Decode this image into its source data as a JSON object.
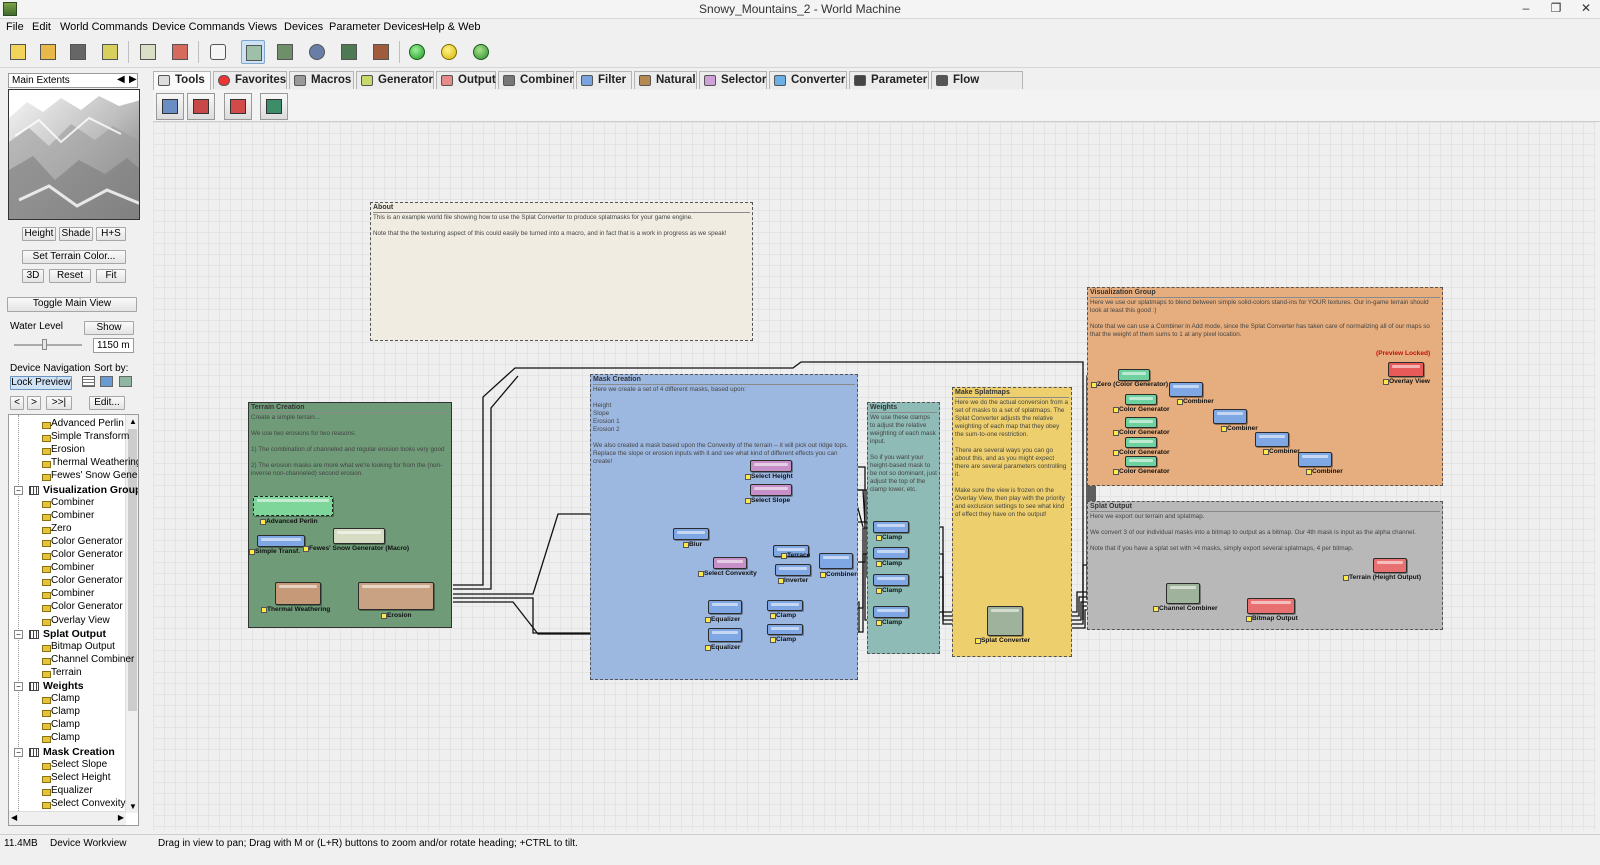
{
  "window": {
    "title": "Snowy_Mountains_2 - World Machine"
  },
  "menu": [
    "File",
    "Edit",
    "World Commands",
    "Device Commands",
    "Views",
    "Devices",
    "Parameter Devices",
    "Help & Web"
  ],
  "left": {
    "extents_label": "Main Extents",
    "view_buttons": [
      "Height",
      "Shade",
      "H+S"
    ],
    "set_terrain_color": "Set Terrain Color...",
    "btn_3d": "3D",
    "btn_reset": "Reset",
    "btn_fit": "Fit",
    "toggle_main_view": "Toggle Main View",
    "water_level_label": "Water Level",
    "water_show": "Show",
    "water_value": "1150 m",
    "device_nav_label": "Device Navigation",
    "sort_by_label": "Sort by:",
    "lock_preview": "Lock Preview",
    "nav_prev": "<",
    "nav_next": ">",
    "nav_last": ">>|",
    "edit_btn": "Edit...",
    "tree": [
      {
        "type": "leaf",
        "label": "Advanced Perlin"
      },
      {
        "type": "leaf",
        "label": "Simple Transform"
      },
      {
        "type": "leaf",
        "label": "Erosion"
      },
      {
        "type": "leaf",
        "label": "Thermal Weathering"
      },
      {
        "type": "leaf",
        "label": "Fewes' Snow Generator"
      },
      {
        "type": "group",
        "label": "Visualization Group"
      },
      {
        "type": "leaf",
        "label": "Combiner"
      },
      {
        "type": "leaf",
        "label": "Combiner"
      },
      {
        "type": "leaf",
        "label": "Zero"
      },
      {
        "type": "leaf",
        "label": "Color Generator"
      },
      {
        "type": "leaf",
        "label": "Color Generator"
      },
      {
        "type": "leaf",
        "label": "Combiner"
      },
      {
        "type": "leaf",
        "label": "Color Generator"
      },
      {
        "type": "leaf",
        "label": "Combiner"
      },
      {
        "type": "leaf",
        "label": "Color Generator"
      },
      {
        "type": "leaf",
        "label": "Overlay View"
      },
      {
        "type": "group",
        "label": "Splat Output"
      },
      {
        "type": "leaf",
        "label": "Bitmap Output"
      },
      {
        "type": "leaf",
        "label": "Channel Combiner"
      },
      {
        "type": "leaf",
        "label": "Terrain"
      },
      {
        "type": "group",
        "label": "Weights"
      },
      {
        "type": "leaf",
        "label": "Clamp"
      },
      {
        "type": "leaf",
        "label": "Clamp"
      },
      {
        "type": "leaf",
        "label": "Clamp"
      },
      {
        "type": "leaf",
        "label": "Clamp"
      },
      {
        "type": "group",
        "label": "Mask Creation"
      },
      {
        "type": "leaf",
        "label": "Select Slope"
      },
      {
        "type": "leaf",
        "label": "Select Height"
      },
      {
        "type": "leaf",
        "label": "Equalizer"
      },
      {
        "type": "leaf",
        "label": "Select Convexity"
      }
    ]
  },
  "tabs": [
    "Tools",
    "Favorites",
    "Macros",
    "Generator",
    "Output",
    "Combiner",
    "Filter",
    "Natural",
    "Selector",
    "Converter",
    "Parameter",
    "Flow Control"
  ],
  "groups": {
    "about": {
      "title": "About",
      "desc": "This is an example world file showing how to use the Splat Converter to produce splatmasks for your game engine.\n\nNote that the the texturing aspect of this could easily be turned into a macro, and in fact that is a work in progress as we speak!"
    },
    "terrain": {
      "title": "Terrain Creation",
      "desc": "Create a simple terrain...\n\nWe use two erosions for two reasons:\n\n1) The combination of channeled and regular erosion looks very good\n\n2) The erosion masks are more what we're looking for from the (non-inverse non-channeled) second erosion."
    },
    "mask": {
      "title": "Mask Creation",
      "desc": "Here we create a set of 4 different masks, based upon:\n\nHeight\nSlope\nErosion 1\nErosion 2\n\nWe also created a mask based upon the Convexity of the terrain -- it will pick out ridge tops. Replace the slope or erosion inputs with it and see what kind of different effects you can create!"
    },
    "weights": {
      "title": "Weights",
      "desc": "We use these clamps to adjust the relative weighting of each mask input.\n\nSo if you want your height-based mask to be not so dominant, just adjust the top of the clamp lower, etc."
    },
    "splat": {
      "title": "Make Splatmaps",
      "desc": "Here we do the actual conversion from a set of masks to a set of splatmaps. The Splat Converter adjusts the relative weighting of each map that they obey the sum-to-one restriction.\n\nThere are several ways you can go about this, and as you might expect there are several parameters controlling it.\n\nMake sure the view is frozen on the Overlay View, then play with the priority and exclusion settings to see what kind of effect they have on the output!"
    },
    "viz": {
      "title": "Visualization Group",
      "desc": "Here we use our splatmaps to blend between simple solid-colors stand-ins for YOUR textures. Our in-game terrain should look at least this good :)\n\nNote that we can use a Combiner in Add mode, since the Splat Converter has taken care of normalizing all of our maps so that the weight of them sums to 1 at any pixel location."
    },
    "output": {
      "title": "Splat Output",
      "desc": "Here we export our terrain and splatmap.\n\nWe convert 3 of our individual masks into a bitmap to output as a bitmap. Our 4th mask is input as the alpha channel.\n\nNote that if you have a splat set with >4 masks, simply export several splatmaps, 4 per bitmap."
    }
  },
  "nodes": {
    "advanced_perlin": "Advanced Perlin",
    "simple_transform": "Simple Transf.",
    "fewes_snow": "Fewes' Snow Generator (Macro)",
    "thermal": "Thermal Weathering",
    "erosion": "Erosion",
    "select_height": "Select Height",
    "select_slope": "Select Slope",
    "blur": "Blur",
    "select_convexity": "Select Convexity",
    "terrace": "Terrace",
    "inverter": "Inverter",
    "combiner_mask": "Combiner",
    "equalizer1": "Equalizer",
    "equalizer2": "Equalizer",
    "clamp_a": "Clamp",
    "clamp_b": "Clamp",
    "w_clamp1": "Clamp",
    "w_clamp2": "Clamp",
    "w_clamp3": "Clamp",
    "w_clamp4": "Clamp",
    "splat_converter": "Splat Converter",
    "zero": "Zero (Color Generator)",
    "color_gen1": "Color Generator",
    "color_gen2": "Color Generator",
    "color_gen3": "Color Generator",
    "color_gen4": "Color Generator",
    "viz_comb1": "Combiner",
    "viz_comb2": "Combiner",
    "viz_comb3": "Combiner",
    "viz_comb4": "Combiner",
    "preview_locked": "(Preview Locked)",
    "overlay_view": "Overlay View",
    "terrain_output": "Terrain (Height Output)",
    "channel_combiner": "Channel Combiner",
    "bitmap_output": "Bitmap Output"
  },
  "status": {
    "memory": "11.4MB",
    "mode": "Device Workview",
    "hint": "Drag in view to pan; Drag with M or (L+R) buttons to zoom and/or rotate heading; +CTRL to tilt."
  },
  "colors": {
    "terrain_group": "#6f9b79",
    "mask_group": "#9db8e0",
    "weights_group": "#8fbbb6",
    "splat_group": "#edcf6d",
    "viz_group": "#e6ae7e",
    "output_group": "#b8b8b8",
    "about_group": "#f0ece2"
  }
}
